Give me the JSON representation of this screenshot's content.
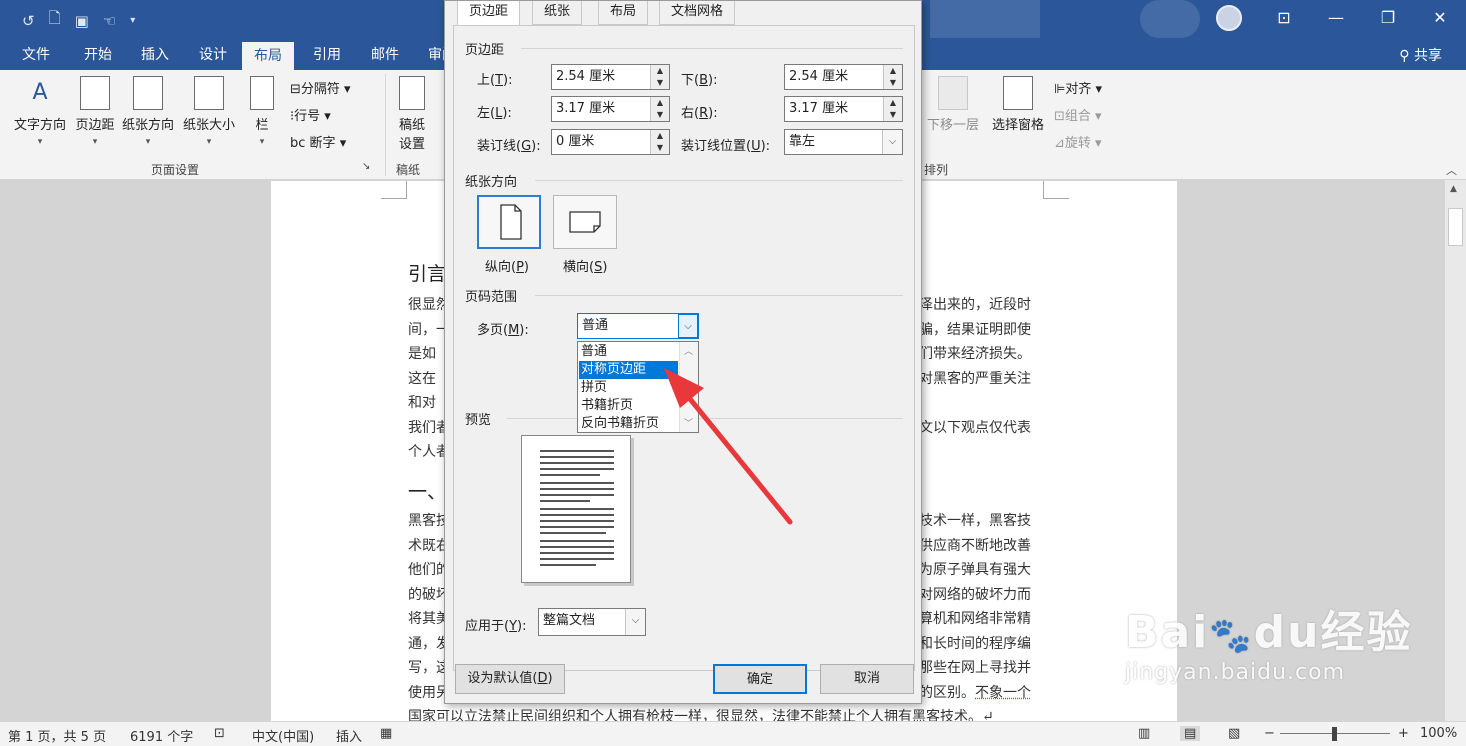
{
  "ribbon_tabs": [
    "文件",
    "开始",
    "插入",
    "设计",
    "布局",
    "引用",
    "邮件",
    "审阅"
  ],
  "share": "共享",
  "ribbon": {
    "text_direction": "文字方向",
    "margins": "页边距",
    "orientation": "纸张方向",
    "size": "纸张大小",
    "columns": "栏",
    "breaks": "分隔符",
    "line_numbers": "行号",
    "hyphenation": "断字",
    "draft_paper_l1": "稿纸",
    "draft_paper_l2": "设置",
    "group_page_setup": "页面设置",
    "group_draft": "稿纸",
    "send_backward": "下移一层",
    "selection_pane": "选择窗格",
    "align": "对齐",
    "group": "组合",
    "rotate": "旋转",
    "group_arrange": "排列"
  },
  "document": {
    "heading1": "引言",
    "para1": [
      "很显然",
      "间，一",
      "是如",
      "这在",
      "和对",
      "我们者",
      "个人者"
    ],
    "para1_right": [
      "泽出来的，近段时",
      "骗，结果证明即使",
      "们带来经济损失。",
      "对黑客的严重关注",
      "",
      "文以下观点仅代表",
      ""
    ],
    "heading2": "一、",
    "para2": [
      "黑客技",
      "术既右",
      "他们的",
      "的破坏",
      "将其美",
      "通，发",
      "写，这",
      "使用另"
    ],
    "para2_right": [
      "技术一样，黑客技",
      "供应商不断地改善",
      "为原子弹具有强大",
      "对网络的破坏力而",
      "算机和网络非常精",
      "和长时间的程序编",
      "那些在网上寻找并",
      "的区别。"
    ],
    "line_last_tail": "不象一个",
    "line_bottom": "国家可以立法禁止民间组织和个人拥有枪枝一样，很显然，法律不能禁止个人拥有黑客技术。↵"
  },
  "dialog": {
    "tabs": [
      "页边距",
      "纸张",
      "布局",
      "文档网格"
    ],
    "section_margins": "页边距",
    "top_label": "上(",
    "top_key": "T",
    "top_val": "2.54 厘米",
    "bottom_label": "下(",
    "bottom_key": "B",
    "bottom_val": "2.54 厘米",
    "left_label": "左(",
    "left_key": "L",
    "left_val": "3.17 厘米",
    "right_label": "右(",
    "right_key": "R",
    "right_val": "3.17 厘米",
    "gutter_label": "装订线(",
    "gutter_key": "G",
    "gutter_val": "0 厘米",
    "gutter_pos_label": "装订线位置(",
    "gutter_pos_key": "U",
    "gutter_pos_val": "靠左",
    "close_paren": "):",
    "section_orientation": "纸张方向",
    "portrait_label": "纵向(",
    "portrait_key": "P",
    "landscape_label": "横向(",
    "landscape_key": "S",
    "paren_close": ")",
    "section_pages": "页码范围",
    "multiple_pages_label": "多页(",
    "multiple_pages_key": "M",
    "multiple_pages_val": "普通",
    "dropdown_options": [
      "普通",
      "对称页边距",
      "拼页",
      "书籍折页",
      "反向书籍折页"
    ],
    "section_preview": "预览",
    "apply_label": "应用于(",
    "apply_key": "Y",
    "apply_val": "整篇文档",
    "set_default": "设为默认值(",
    "set_default_key": "D",
    "ok": "确定",
    "cancel": "取消"
  },
  "status": {
    "page": "第 1 页，共 5 页",
    "words": "6191 个字",
    "language": "中文(中国)",
    "mode": "插入",
    "zoom": "100%"
  },
  "watermark": {
    "brand_a": "Bai",
    "brand_b": "du",
    "brand_c": "经验",
    "url": "jingyan.baidu.com"
  },
  "colors": {
    "titlebar": "#2b579a",
    "highlight": "#0078d7",
    "arrow": "#e8383b"
  }
}
